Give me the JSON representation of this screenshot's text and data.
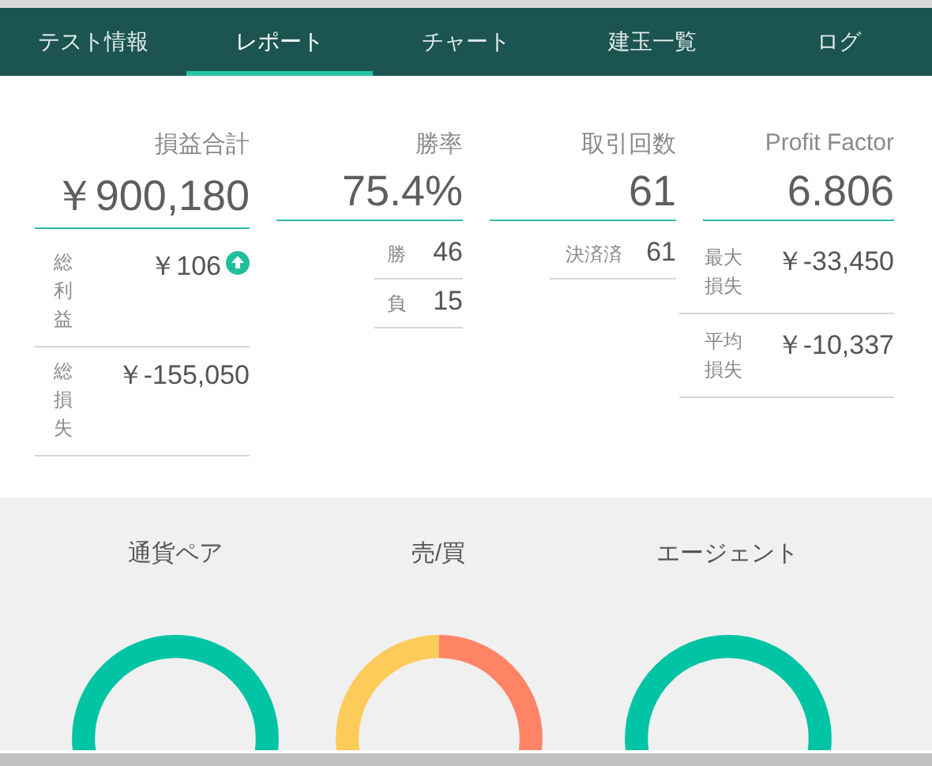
{
  "tabs": [
    {
      "label": "テスト情報",
      "selected": false
    },
    {
      "label": "レポート",
      "selected": true
    },
    {
      "label": "チャート",
      "selected": false
    },
    {
      "label": "建玉一覧",
      "selected": false
    },
    {
      "label": "ログ",
      "selected": false
    }
  ],
  "stats": [
    {
      "label": "損益合計",
      "value": "￥900,180",
      "details": [
        {
          "label": "総利益",
          "value": "￥106"
        },
        {
          "label": "総損失",
          "value": "￥-155,050"
        }
      ]
    },
    {
      "label": "勝率",
      "value": "75.4%",
      "details": [
        {
          "label": "勝",
          "value": "46"
        },
        {
          "label": "負",
          "value": "15"
        }
      ]
    },
    {
      "label": "取引回数",
      "value": "61",
      "details": [
        {
          "label": "決済済",
          "value": "61"
        }
      ]
    },
    {
      "label": "Profit Factor",
      "value": "6.806",
      "details": [
        {
          "label": "最大損失",
          "value": "￥-33,450"
        },
        {
          "label": "平均損失",
          "value": "￥-10,337"
        }
      ]
    }
  ],
  "charts": [
    {
      "title": "通貨ペア",
      "kind": "single"
    },
    {
      "title": "売/買",
      "kind": "split"
    },
    {
      "title": "エージェント",
      "kind": "single"
    }
  ]
}
